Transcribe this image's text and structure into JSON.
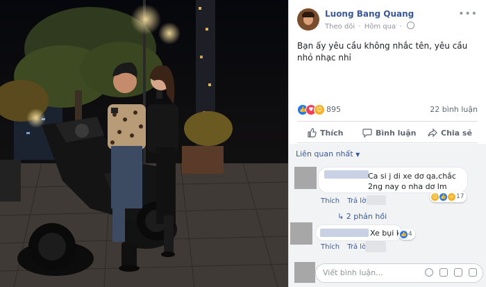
{
  "post": {
    "author": "Luong Bang Quang",
    "follow": "Theo dõi",
    "time": "Hôm qua",
    "text": "Bạn ấy yêu cầu không nhắc tên, yêu cầu nhỏ nhạc nhỉ",
    "reaction_count": "895",
    "comment_count": "22 bình luận"
  },
  "actions": {
    "like": "Thích",
    "comment": "Bình luận",
    "share": "Chia sẻ"
  },
  "comments_sort": "Liên quan nhất",
  "comments": [
    {
      "text": "Ca si j di xe dơ qa,chắc 2ng nay o nha dơ lm",
      "like_label": "Thích",
      "reply_label": "Trả lời",
      "reaction_count": "17",
      "replies_label": "2 phản hồi"
    },
    {
      "text": "Xe bụi ko",
      "like_label": "Thích",
      "reply_label": "Trả lời",
      "reaction_count": "4"
    }
  ],
  "composer": {
    "placeholder": "Viết bình luận..."
  },
  "colors": {
    "link": "#385898",
    "like_blue": "#2078f4",
    "love_red": "#f33e58",
    "haha_yellow": "#f7b125",
    "comment_bg": "#f2f3f5"
  }
}
